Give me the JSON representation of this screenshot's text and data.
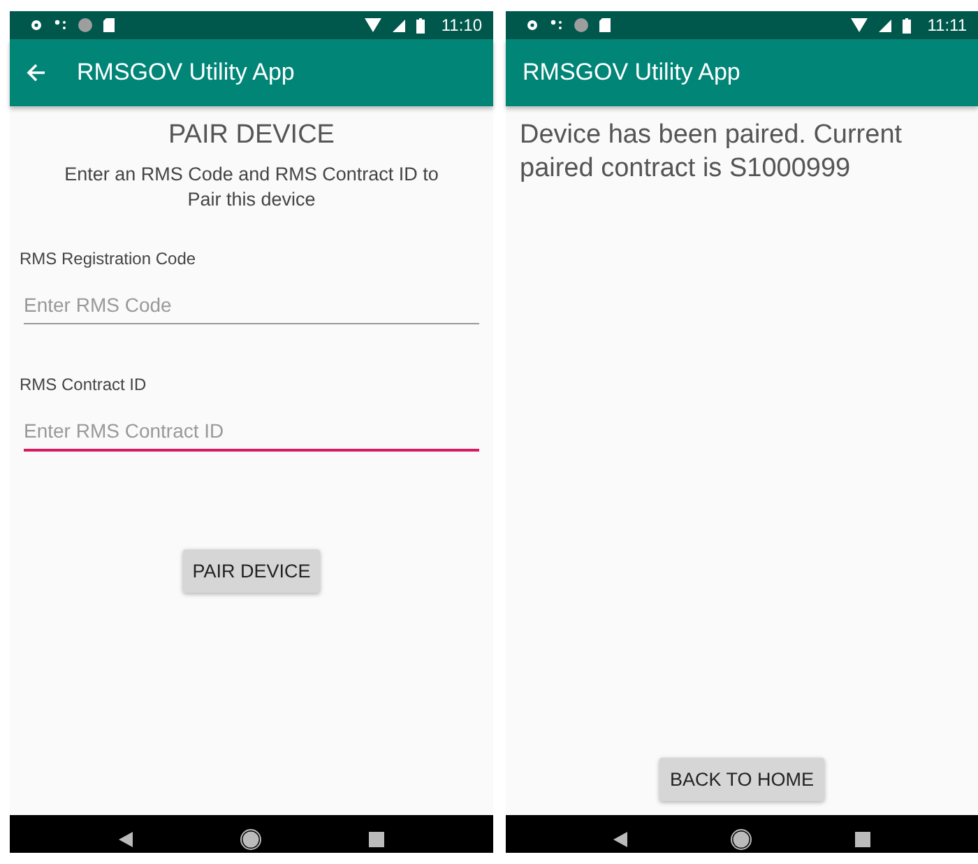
{
  "screens": [
    {
      "status_bar": {
        "time": "11:10"
      },
      "toolbar": {
        "title": "RMSGOV Utility App",
        "back": true
      },
      "heading": "PAIR DEVICE",
      "instructions": "Enter an RMS Code and RMS Contract ID to Pair this device",
      "fields": [
        {
          "label": "RMS Registration Code",
          "placeholder": "Enter RMS Code",
          "focused": false
        },
        {
          "label": "RMS Contract ID",
          "placeholder": "Enter RMS Contract ID",
          "focused": true
        }
      ],
      "button": "PAIR DEVICE"
    },
    {
      "status_bar": {
        "time": "11:11"
      },
      "toolbar": {
        "title": "RMSGOV Utility App",
        "back": false
      },
      "message": "Device has been paired. Current paired contract is S1000999",
      "bottom_button": "BACK TO HOME"
    }
  ]
}
